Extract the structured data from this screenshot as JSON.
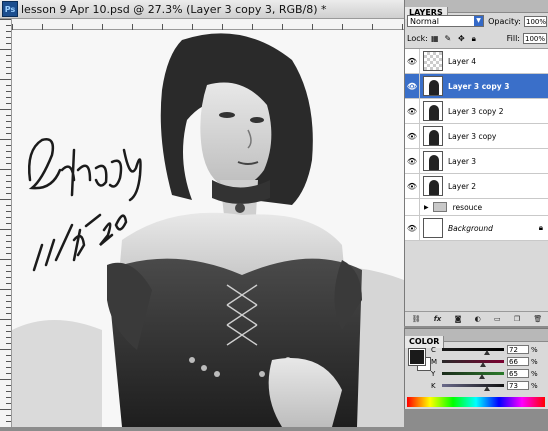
{
  "document": {
    "title": "lesson 9 Apr 10.psd @ 27.3% (Layer 3 copy 3, RGB/8) *",
    "app_badge": "Ps",
    "signature_text": "Esther Yii",
    "signature_date": "11/4/2010"
  },
  "layers_panel": {
    "tab_label": "LAYERS",
    "blend_mode": "Normal",
    "opacity_label": "Opacity:",
    "opacity_value": "100%",
    "lock_label": "Lock:",
    "fill_label": "Fill:",
    "fill_value": "100%",
    "layers": [
      {
        "name": "Layer 4",
        "thumb": "transparent",
        "selected": false
      },
      {
        "name": "Layer 3 copy 3",
        "thumb": "figure",
        "selected": true
      },
      {
        "name": "Layer 3 copy 2",
        "thumb": "figure",
        "selected": false
      },
      {
        "name": "Layer 3 copy",
        "thumb": "figure",
        "selected": false
      },
      {
        "name": "Layer 3",
        "thumb": "figure",
        "selected": false
      },
      {
        "name": "Layer 2",
        "thumb": "figure",
        "selected": false
      },
      {
        "name": "resouce",
        "thumb": "folder",
        "selected": false
      },
      {
        "name": "Background",
        "thumb": "white",
        "selected": false
      }
    ],
    "footer_icons": [
      "link-icon",
      "fx-icon",
      "mask-icon",
      "adjustment-icon",
      "folder-icon",
      "new-layer-icon",
      "trash-icon"
    ]
  },
  "color_panel": {
    "tab_label": "COLOR",
    "channels": [
      {
        "label": "C",
        "value": "72",
        "unit": "%",
        "fraction": 0.72
      },
      {
        "label": "M",
        "value": "66",
        "unit": "%",
        "fraction": 0.66
      },
      {
        "label": "Y",
        "value": "65",
        "unit": "%",
        "fraction": 0.65
      },
      {
        "label": "K",
        "value": "73",
        "unit": "%",
        "fraction": 0.73
      }
    ],
    "foreground": "#1a1a1a",
    "background": "#ffffff"
  },
  "colors": {
    "selection": "#3a6fc9",
    "panel": "#d9d9d9"
  }
}
